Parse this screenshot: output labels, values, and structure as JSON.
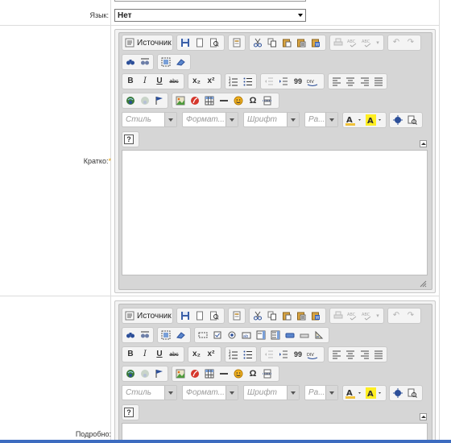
{
  "form": {
    "language": {
      "label": "Язык:",
      "value": "Нет"
    },
    "short": {
      "label": "Кратко:",
      "required_mark": "*"
    },
    "full": {
      "label": "Подробно:",
      "required_mark": ""
    }
  },
  "editor": {
    "source_label": "Источник",
    "combos": {
      "style": "Стиль",
      "format": "Формат...",
      "font": "Шрифт",
      "size": "Ра..."
    },
    "glyphs": {
      "bold": "B",
      "italic": "I",
      "underline": "U",
      "strike": "abc",
      "subscript": "x₂",
      "superscript": "x²",
      "blockquote": "99",
      "omega": "Ω",
      "help": "?"
    }
  },
  "colors": {
    "required": "#e6a000",
    "taskbar": "#3d6cc0"
  }
}
